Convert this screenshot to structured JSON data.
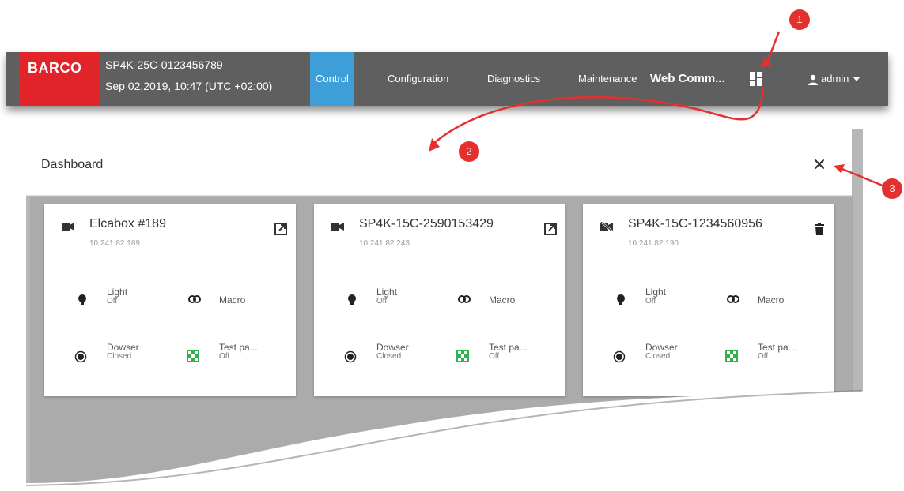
{
  "header": {
    "logo": "BARCO",
    "device_name": "SP4K-25C-0123456789",
    "date_time": "Sep 02,2019, 10:47 (UTC +02:00)",
    "tabs": [
      {
        "label": "Control",
        "active": true
      },
      {
        "label": "Configuration",
        "active": false
      },
      {
        "label": "Diagnostics",
        "active": false
      },
      {
        "label": "Maintenance",
        "active": false
      }
    ],
    "web_comm": "Web Comm...",
    "user": "admin"
  },
  "callouts": [
    "1",
    "2",
    "3"
  ],
  "dashboard": {
    "title": "Dashboard",
    "cards": [
      {
        "name": "Elcabox #189",
        "ip": "10.241.82.189",
        "camera_icon": "camera-icon",
        "action_icon": "open-external-icon",
        "tiles": [
          {
            "label": "Light",
            "status": "Off"
          },
          {
            "label": "Macro",
            "status": ""
          },
          {
            "label": "Dowser",
            "status": "Closed"
          },
          {
            "label": "Test pa...",
            "status": "Off"
          }
        ]
      },
      {
        "name": "SP4K-15C-2590153429",
        "ip": "10.241.82.243",
        "camera_icon": "camera-icon",
        "action_icon": "open-external-icon",
        "tiles": [
          {
            "label": "Light",
            "status": "Off"
          },
          {
            "label": "Macro",
            "status": ""
          },
          {
            "label": "Dowser",
            "status": "Closed"
          },
          {
            "label": "Test pa...",
            "status": "Off"
          }
        ]
      },
      {
        "name": "SP4K-15C-1234560956",
        "ip": "10.241.82.190",
        "camera_icon": "camera-off-icon",
        "action_icon": "trash-icon",
        "tiles": [
          {
            "label": "Light",
            "status": "Off"
          },
          {
            "label": "Macro",
            "status": ""
          },
          {
            "label": "Dowser",
            "status": "Closed"
          },
          {
            "label": "Test pa...",
            "status": "Off"
          }
        ]
      }
    ]
  },
  "colors": {
    "barco_red": "#e1242a",
    "active_tab": "#3e9fd8",
    "topbar": "#5f5f5f",
    "callout": "#e53030",
    "test_pattern_green": "#2db34a"
  }
}
